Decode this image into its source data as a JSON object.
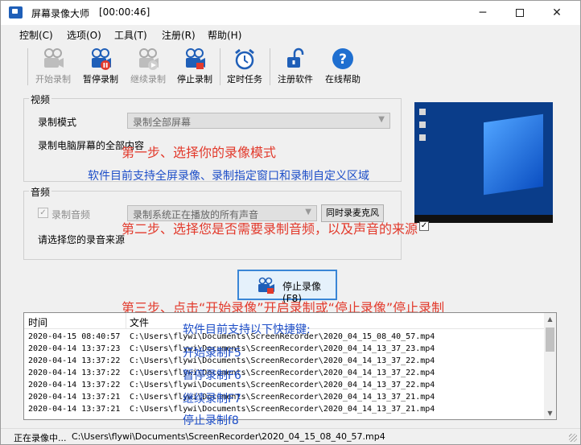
{
  "window": {
    "title": "屏幕录像大师",
    "timer": "[00:00:46]"
  },
  "menu": [
    "控制(C)",
    "选项(O)",
    "工具(T)",
    "注册(R)",
    "帮助(H)"
  ],
  "toolbar": {
    "start": "开始录制",
    "pause": "暂停录制",
    "resume": "继续录制",
    "stop": "停止录制",
    "schedule": "定时任务",
    "register": "注册软件",
    "help": "在线帮助"
  },
  "video": {
    "group_title": "视频",
    "mode_label": "录制模式",
    "mode_value": "录制全部屏幕",
    "description": "录制电脑屏幕的全部内容"
  },
  "audio": {
    "group_title": "音频",
    "record_audio_label": "录制音频",
    "record_audio_checked": true,
    "source_value": "录制系统正在播放的所有声音",
    "mic_button": "同时录麦克风",
    "source_hint": "请选择您的录音来源"
  },
  "notes": {
    "step1": "第一步、选择你的录像模式",
    "step1_info": "软件目前支持全屏录像、录制指定窗口和录制自定义区域",
    "step2": "第二步、选择您是否需要录制音频，以及声音的来源",
    "step3": "第三步、点击“开始录像”开启录制或“停止录像”停止录制",
    "shortcut_title": "软件目前支持以下快捷键:",
    "shortcut_start": "开始录制F5",
    "shortcut_pause": "暂停录制F6",
    "shortcut_resume": "继续录制F7",
    "shortcut_stop": "停止录制f8"
  },
  "main_button": "停止录像(F8)",
  "log": {
    "col_time": "时间",
    "col_file": "文件",
    "rows": [
      {
        "time": "2020-04-15 08:40:57",
        "file": "C:\\Users\\flywi\\Documents\\ScreenRecorder\\2020_04_15_08_40_57.mp4"
      },
      {
        "time": "2020-04-14 13:37:23",
        "file": "C:\\Users\\flywi\\Documents\\ScreenRecorder\\2020_04_14_13_37_23.mp4"
      },
      {
        "time": "2020-04-14 13:37:22",
        "file": "C:\\Users\\flywi\\Documents\\ScreenRecorder\\2020_04_14_13_37_22.mp4"
      },
      {
        "time": "2020-04-14 13:37:22",
        "file": "C:\\Users\\flywi\\Documents\\ScreenRecorder\\2020_04_14_13_37_22.mp4"
      },
      {
        "time": "2020-04-14 13:37:22",
        "file": "C:\\Users\\flywi\\Documents\\ScreenRecorder\\2020_04_14_13_37_22.mp4"
      },
      {
        "time": "2020-04-14 13:37:21",
        "file": "C:\\Users\\flywi\\Documents\\ScreenRecorder\\2020_04_14_13_37_21.mp4"
      },
      {
        "time": "2020-04-14 13:37:21",
        "file": "C:\\Users\\flywi\\Documents\\ScreenRecorder\\2020_04_14_13_37_21.mp4"
      }
    ]
  },
  "status": {
    "state": "正在录像中...",
    "file": "C:\\Users\\flywi\\Documents\\ScreenRecorder\\2020_04_15_08_40_57.mp4"
  },
  "icons": {
    "title_controls": [
      "minimize-icon",
      "maximize-icon",
      "close-icon"
    ],
    "toolbar": [
      "camera-start-icon",
      "camera-pause-icon",
      "camera-resume-icon",
      "camera-stop-icon",
      "alarm-clock-icon",
      "unlock-icon",
      "help-icon"
    ]
  },
  "colors": {
    "step_text": "#e23a2c",
    "info_text": "#1d4ec8",
    "accent": "#3a86d6"
  }
}
